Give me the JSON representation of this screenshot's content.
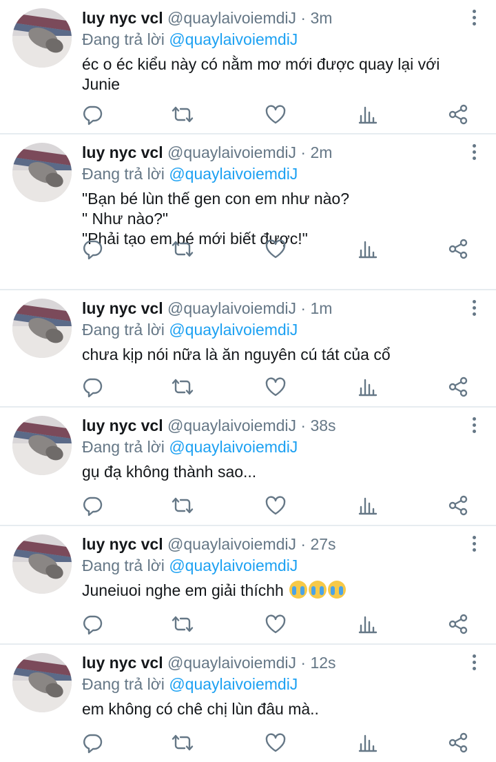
{
  "author": {
    "name": "luy nyc vcl",
    "handle": "@quaylaivoiemdiJ",
    "reply_prefix": "Đang trả lời",
    "reply_to": "@quaylaivoiemdiJ"
  },
  "tweets": [
    {
      "time": "3m",
      "lines": [
        "éc o éc kiểu này có nằm mơ mới được quay lại với",
        "Junie"
      ]
    },
    {
      "time": "2m",
      "lines": [
        "\"Bạn bé lùn thế gen con em như nào?",
        "\" Như nào?\"",
        "\"Phải tạo em bé mới biết được!\""
      ]
    },
    {
      "time": "1m",
      "lines": [
        "chưa kịp nói nữa là ăn nguyên cú tát của cổ"
      ]
    },
    {
      "time": "38s",
      "lines": [
        "gụ đạ không thành sao..."
      ]
    },
    {
      "time": "27s",
      "lines": [
        "Juneiuoi nghe em giải thíchh"
      ],
      "emojis": [
        "loudly-crying-face",
        "loudly-crying-face",
        "loudly-crying-face"
      ]
    },
    {
      "time": "12s",
      "lines": [
        "em không có chê chị lùn đâu mà.."
      ]
    }
  ],
  "separator": "·",
  "colors": {
    "text": "#14171a",
    "secondary": "#657786",
    "link": "#1da1f2",
    "divider": "#e6ecf0"
  },
  "icons": [
    "reply-icon",
    "retweet-icon",
    "like-icon",
    "analytics-icon",
    "share-icon",
    "more-options-icon"
  ]
}
